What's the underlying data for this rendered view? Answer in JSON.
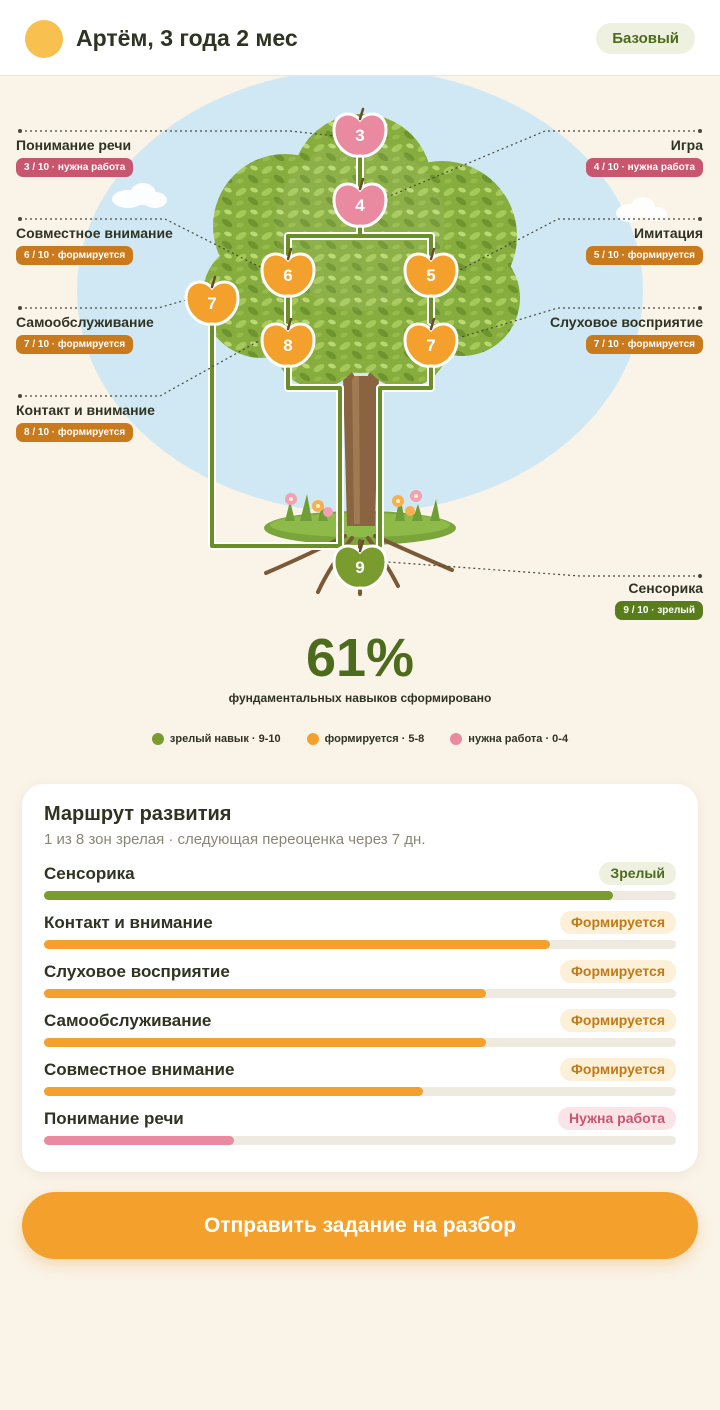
{
  "header": {
    "child_name": "Артём, 3 года 2 мес",
    "plan_badge": "Базовый"
  },
  "colors": {
    "mature": "#7a9c2e",
    "forming": "#f4a02c",
    "needs_work": "#e98aa1",
    "accent": "#f4a02c",
    "sky": "#cfe8f3"
  },
  "tree": {
    "zones": [
      {
        "id": "speech",
        "name": "Понимание речи",
        "tag": "3 / 10 · нужна работа",
        "score": 3,
        "status": "needs_work"
      },
      {
        "id": "play",
        "name": "Игра",
        "tag": "4 / 10 · нужна работа",
        "score": 4,
        "status": "needs_work"
      },
      {
        "id": "joint",
        "name": "Совместное внимание",
        "tag": "6 / 10 · формируется",
        "score": 6,
        "status": "forming"
      },
      {
        "id": "imitation",
        "name": "Имитация",
        "tag": "5 / 10 · формируется",
        "score": 5,
        "status": "forming"
      },
      {
        "id": "selfcare",
        "name": "Самообслуживание",
        "tag": "7 / 10 · формируется",
        "score": 7,
        "status": "forming"
      },
      {
        "id": "auditory",
        "name": "Слуховое восприятие",
        "tag": "7 / 10 · формируется",
        "score": 7,
        "status": "forming"
      },
      {
        "id": "contact",
        "name": "Контакт и внимание",
        "tag": "8 / 10 · формируется",
        "score": 8,
        "status": "forming"
      },
      {
        "id": "sensory",
        "name": "Сенсорика",
        "tag": "9 / 10 · зрелый",
        "score": 9,
        "status": "mature"
      }
    ]
  },
  "summary": {
    "percent": "61%",
    "caption": "фундаментальных навыков сформировано"
  },
  "legend": [
    {
      "label": "зрелый навык · 9-10",
      "color": "#7a9c2e"
    },
    {
      "label": "формируется · 5-8",
      "color": "#f4a02c"
    },
    {
      "label": "нужна работа · 0-4",
      "color": "#e98aa1"
    }
  ],
  "route": {
    "title": "Маршрут развития",
    "subtitle": "1 из 8 зон зрелая · следующая переоценка через 7 дн.",
    "items": [
      {
        "name": "Сенсорика",
        "badge": "Зрелый",
        "status": "mature",
        "progress": 0.9
      },
      {
        "name": "Контакт и внимание",
        "badge": "Формируется",
        "status": "forming",
        "progress": 0.8
      },
      {
        "name": "Слуховое восприятие",
        "badge": "Формируется",
        "status": "forming",
        "progress": 0.7
      },
      {
        "name": "Самообслуживание",
        "badge": "Формируется",
        "status": "forming",
        "progress": 0.7
      },
      {
        "name": "Совместное внимание",
        "badge": "Формируется",
        "status": "forming",
        "progress": 0.6
      },
      {
        "name": "Понимание речи",
        "badge": "Нужна работа",
        "status": "needs_work",
        "progress": 0.3
      }
    ]
  },
  "cta": {
    "label": "Отправить задание на разбор"
  }
}
